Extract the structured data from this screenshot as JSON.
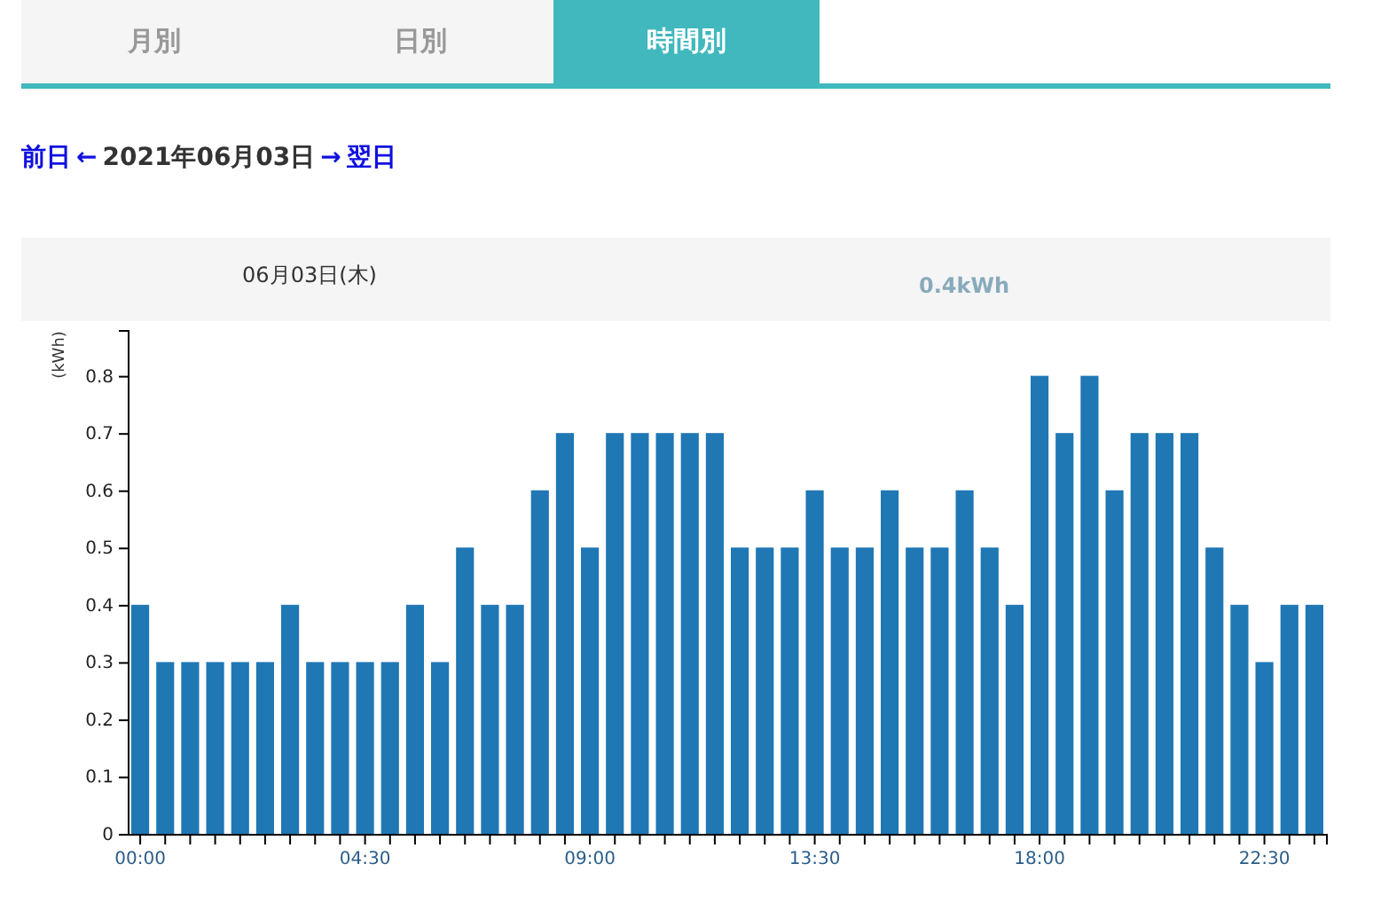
{
  "tabs": [
    {
      "label": "月別",
      "selected": false
    },
    {
      "label": "日別",
      "selected": false
    },
    {
      "label": "時間別",
      "selected": true
    }
  ],
  "nav": {
    "prev_link": "前日",
    "left_arrow": "←",
    "date": "2021年06月03日",
    "right_arrow": "→",
    "next_link": "翌日"
  },
  "summary": {
    "date": "06月03日(木)",
    "total": "0.4kWh"
  },
  "chart": {
    "chart_data": {
      "type": "bar",
      "ylabel": "(kWh)",
      "ylim": [
        0,
        0.88
      ],
      "yticks": [
        0,
        0.1,
        0.2,
        0.3,
        0.4,
        0.5,
        0.6,
        0.7,
        0.8
      ],
      "categories": [
        "00:00",
        null,
        null,
        null,
        null,
        null,
        null,
        null,
        null,
        "04:30",
        null,
        null,
        null,
        null,
        null,
        null,
        null,
        null,
        "09:00",
        null,
        null,
        null,
        null,
        null,
        null,
        null,
        null,
        "13:30",
        null,
        null,
        null,
        null,
        null,
        null,
        null,
        null,
        "18:00",
        null,
        null,
        null,
        null,
        null,
        null,
        null,
        null,
        "22:30",
        null,
        null
      ],
      "series": [
        {
          "color": "#1f77b4",
          "values": [
            0.4,
            0.3,
            0.3,
            0.3,
            0.3,
            0.3,
            0.4,
            0.3,
            0.3,
            0.3,
            0.3,
            0.4,
            0.3,
            0.5,
            0.4,
            0.4,
            0.6,
            0.7,
            0.5,
            0.7,
            0.7,
            0.7,
            0.7,
            0.7,
            0.5,
            0.5,
            0.5,
            0.6,
            0.5,
            0.5,
            0.6,
            0.5,
            0.5,
            0.6,
            0.5,
            0.4,
            0.8,
            0.7,
            0.8,
            0.6,
            0.7,
            0.7,
            0.7,
            0.5,
            0.4,
            0.3,
            0.4,
            0.4
          ]
        }
      ]
    }
  }
}
